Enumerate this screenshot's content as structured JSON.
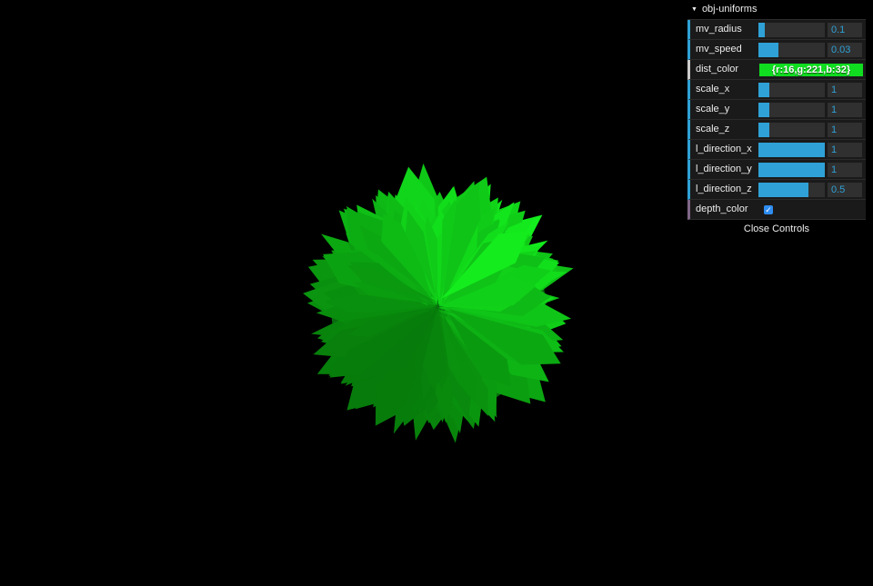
{
  "scene": {
    "object_color": "#10dd20"
  },
  "gui": {
    "folder_title": "obj-uniforms",
    "sliders": [
      {
        "label": "mv_radius",
        "value": "0.1",
        "fill": 0.1
      },
      {
        "label": "mv_speed",
        "value": "0.03",
        "fill": 0.3
      },
      {
        "label": "scale_x",
        "value": "1",
        "fill": 0.17
      },
      {
        "label": "scale_y",
        "value": "1",
        "fill": 0.17
      },
      {
        "label": "scale_z",
        "value": "1",
        "fill": 0.17
      },
      {
        "label": "l_direction_x",
        "value": "1",
        "fill": 1.0
      },
      {
        "label": "l_direction_y",
        "value": "1",
        "fill": 1.0
      },
      {
        "label": "l_direction_z",
        "value": "0.5",
        "fill": 0.75
      }
    ],
    "dist_color": {
      "label": "dist_color",
      "value": "{r:16,g:221,b:32}",
      "color": "#10dd20"
    },
    "depth_color": {
      "label": "depth_color",
      "checked": true
    },
    "close_label": "Close Controls"
  }
}
